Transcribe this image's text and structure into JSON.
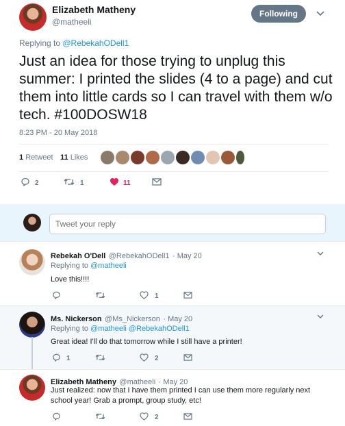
{
  "main_tweet": {
    "author_name": "Elizabeth Matheny",
    "author_handle": "@matheeli",
    "follow_label": "Following",
    "replying_to_prefix": "Replying to ",
    "replying_to_handle": "@RebekahODell1",
    "text": "Just an idea for those trying to unplug this summer: I printed the slides (4 to a page) and cut them into little cards so I can travel with them w/o tech. #100DOSW18",
    "timestamp": "8:23 PM - 20 May 2018",
    "retweet_count": "1",
    "retweet_label": "Retweet",
    "likes_count": "11",
    "likes_label": "Likes",
    "replies": "2",
    "retweets": "1",
    "likes": "11"
  },
  "reply_box": {
    "placeholder": "Tweet your reply"
  },
  "replies": [
    {
      "name": "Rebekah O'Dell",
      "handle": "@RebekahODell1",
      "date": "· May 20",
      "replying_to_prefix": "Replying to ",
      "replying_to": "@matheeli",
      "text": "Love this!!!!",
      "replies": "",
      "retweets": "",
      "likes": "1"
    },
    {
      "name": "Ms. Nickerson",
      "handle": "@Ms_Nickerson",
      "date": "· May 20",
      "replying_to_prefix": "Replying to ",
      "replying_to": "@matheeli @RebekahODell1",
      "text": "Great idea! I'll do that tomorrow while I still have a printer!",
      "replies": "1",
      "retweets": "",
      "likes": "2"
    },
    {
      "name": "Elizabeth Matheny",
      "handle": "@matheeli",
      "date": "· May 20",
      "text": "Just realized: now that I have them printed I can use them more regularly next school year! Grab a prompt, group study, etc!",
      "replies": "",
      "retweets": "",
      "likes": "2"
    }
  ],
  "colors": {
    "accent": "#1da1f2",
    "like_red": "#e0245e",
    "muted": "#657786",
    "follow_bg": "#657786"
  },
  "icons": [
    "chevron-down-icon",
    "reply-icon",
    "retweet-icon",
    "heart-icon",
    "message-icon"
  ]
}
